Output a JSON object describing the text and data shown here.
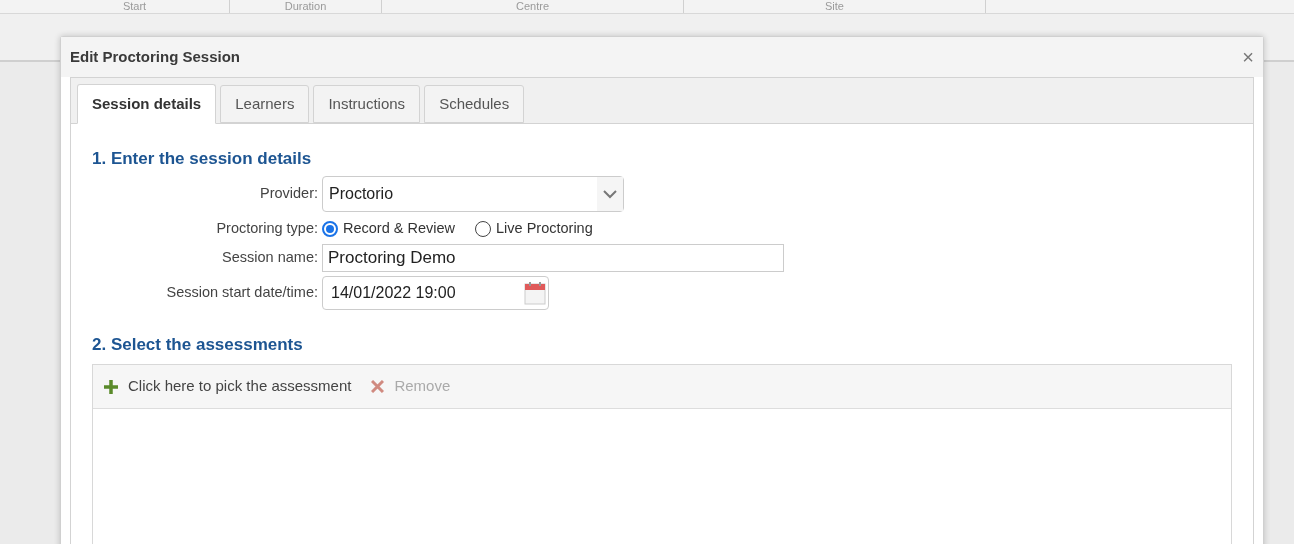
{
  "background_table": {
    "columns": [
      "Start",
      "Duration",
      "Centre",
      "Site"
    ]
  },
  "dialog": {
    "title": "Edit Proctoring Session",
    "close": "×",
    "tabs": [
      {
        "label": "Session details",
        "selected": true
      },
      {
        "label": "Learners",
        "selected": false
      },
      {
        "label": "Instructions",
        "selected": false
      },
      {
        "label": "Schedules",
        "selected": false
      }
    ],
    "section_1": {
      "heading": "1. Enter the session details",
      "provider": {
        "label": "Provider:",
        "value": "Proctorio"
      },
      "proctoring_type": {
        "label": "Proctoring type:",
        "options": [
          {
            "label": "Record & Review",
            "selected": true
          },
          {
            "label": "Live Proctoring",
            "selected": false
          }
        ]
      },
      "session_name": {
        "label": "Session name:",
        "value": "Proctoring Demo"
      },
      "start": {
        "label": "Session start date/time:",
        "value": "14/01/2022 19:00"
      }
    },
    "section_2": {
      "heading": "2. Select the assessments",
      "toolbar": [
        {
          "kind": "add",
          "label": "Click here to pick the assessment",
          "disabled": false
        },
        {
          "kind": "remove",
          "label": "Remove",
          "disabled": true
        }
      ]
    }
  }
}
